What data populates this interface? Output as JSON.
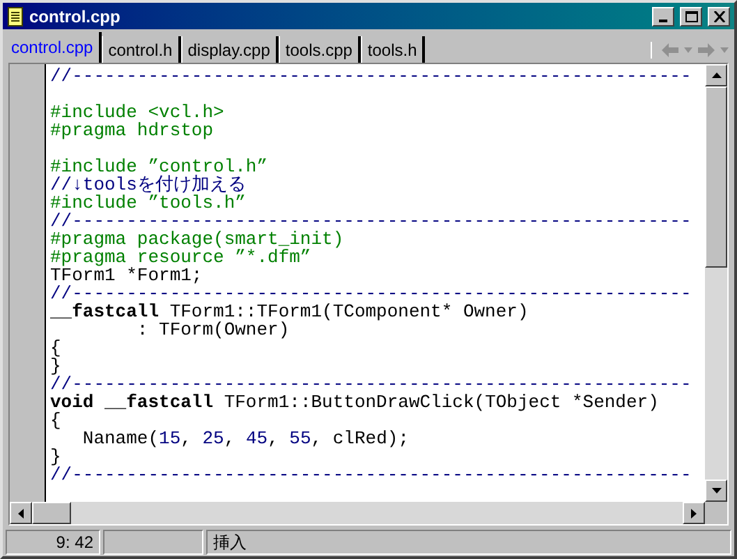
{
  "window": {
    "title": "control.cpp"
  },
  "tabs": [
    {
      "label": "control.cpp",
      "selected": true
    },
    {
      "label": "control.h",
      "selected": false
    },
    {
      "label": "display.cpp",
      "selected": false
    },
    {
      "label": "tools.cpp",
      "selected": false
    },
    {
      "label": "tools.h",
      "selected": false
    }
  ],
  "code_lines": [
    [
      {
        "kind": "comment",
        "text": "//---------------------------------------------------------"
      }
    ],
    [
      {
        "kind": "blank"
      }
    ],
    [
      {
        "kind": "directive",
        "text": "#include <vcl.h>"
      }
    ],
    [
      {
        "kind": "directive",
        "text": "#pragma hdrstop"
      }
    ],
    [
      {
        "kind": "blank"
      }
    ],
    [
      {
        "kind": "directive",
        "text": "#include ”control.h”"
      }
    ],
    [
      {
        "kind": "comment",
        "text": "//↓toolsを付け加える"
      }
    ],
    [
      {
        "kind": "directive",
        "text": "#include ”tools.h”"
      }
    ],
    [
      {
        "kind": "comment",
        "text": "//---------------------------------------------------------"
      }
    ],
    [
      {
        "kind": "directive",
        "text": "#pragma package(smart_init)"
      }
    ],
    [
      {
        "kind": "directive",
        "text": "#pragma resource ”*.dfm”"
      }
    ],
    [
      {
        "kind": "plain",
        "text": "TForm1 *Form1;"
      }
    ],
    [
      {
        "kind": "comment",
        "text": "//---------------------------------------------------------"
      }
    ],
    [
      {
        "kind": "keyword",
        "text": "__fastcall"
      },
      {
        "kind": "plain",
        "text": " TForm1::TForm1(TComponent* Owner)"
      }
    ],
    [
      {
        "kind": "plain",
        "text": "        : TForm(Owner)"
      }
    ],
    [
      {
        "kind": "plain",
        "text": "{"
      }
    ],
    [
      {
        "kind": "plain",
        "text": "}"
      }
    ],
    [
      {
        "kind": "comment",
        "text": "//---------------------------------------------------------"
      }
    ],
    [
      {
        "kind": "keyword",
        "text": "void __fastcall"
      },
      {
        "kind": "plain",
        "text": " TForm1::ButtonDrawClick(TObject *Sender)"
      }
    ],
    [
      {
        "kind": "plain",
        "text": "{"
      }
    ],
    [
      {
        "kind": "plain",
        "text": "   Naname("
      },
      {
        "kind": "number",
        "text": "15"
      },
      {
        "kind": "plain",
        "text": ", "
      },
      {
        "kind": "number",
        "text": "25"
      },
      {
        "kind": "plain",
        "text": ", "
      },
      {
        "kind": "number",
        "text": "45"
      },
      {
        "kind": "plain",
        "text": ", "
      },
      {
        "kind": "number",
        "text": "55"
      },
      {
        "kind": "plain",
        "text": ", clRed);"
      }
    ],
    [
      {
        "kind": "plain",
        "text": "}"
      }
    ],
    [
      {
        "kind": "comment",
        "text": "//---------------------------------------------------------"
      }
    ]
  ],
  "status_bar": [
    {
      "kind": "text",
      "text": "9: 42"
    },
    {
      "kind": "empty"
    },
    {
      "kind": "text",
      "text": "挿入"
    }
  ]
}
